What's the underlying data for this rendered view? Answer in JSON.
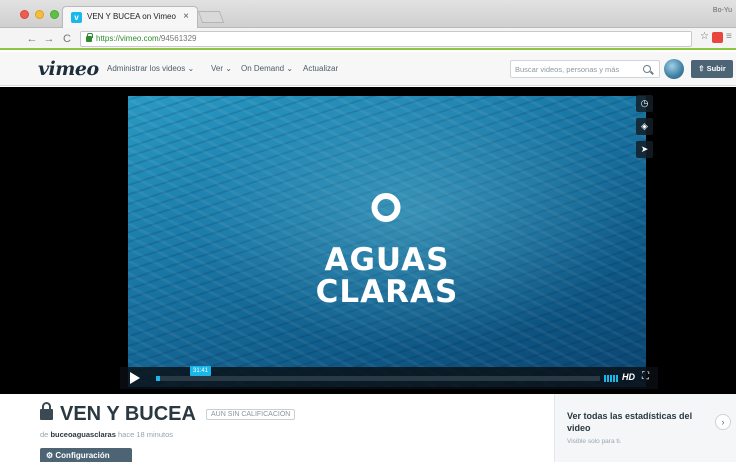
{
  "browser": {
    "tab_title": "VEN Y BUCEA on Vimeo",
    "tab_close": "×",
    "profile": "Bo-Yu",
    "url_host": "https://vimeo.com",
    "url_path": "/94561329",
    "nav_back": "←",
    "nav_forward": "→",
    "nav_reload": "C",
    "bookmark_star": "☆",
    "menu": "≡",
    "favicon_letter": "v"
  },
  "header": {
    "logo": "vimeo",
    "nav": [
      "Administrar los videos ⌄",
      "Ver ⌄",
      "On Demand ⌄",
      "Actualizar"
    ],
    "search_placeholder": "Buscar videos, personas y más",
    "upload_label": "⇧ Subir"
  },
  "player": {
    "title_line1": "AGUAS",
    "title_line2": "CLARAS",
    "timecode": "31:41",
    "progress": 0.01,
    "hd_label": "HD",
    "fullscreen": "⛶",
    "side_buttons": [
      "◷",
      "◈",
      "➤"
    ]
  },
  "video_info": {
    "title": "VEN Y BUCEA",
    "rating": "AÚN SIN CALIFICACIÓN",
    "by_prefix": "de",
    "author": "buceoaguasclaras",
    "time_ago": "hace 18 minutos",
    "settings_label": "⚙  Configuración"
  },
  "stats": {
    "title": "Ver todas las estadísticas del video",
    "subtitle": "Visible solo para ti.",
    "arrow": "›"
  }
}
